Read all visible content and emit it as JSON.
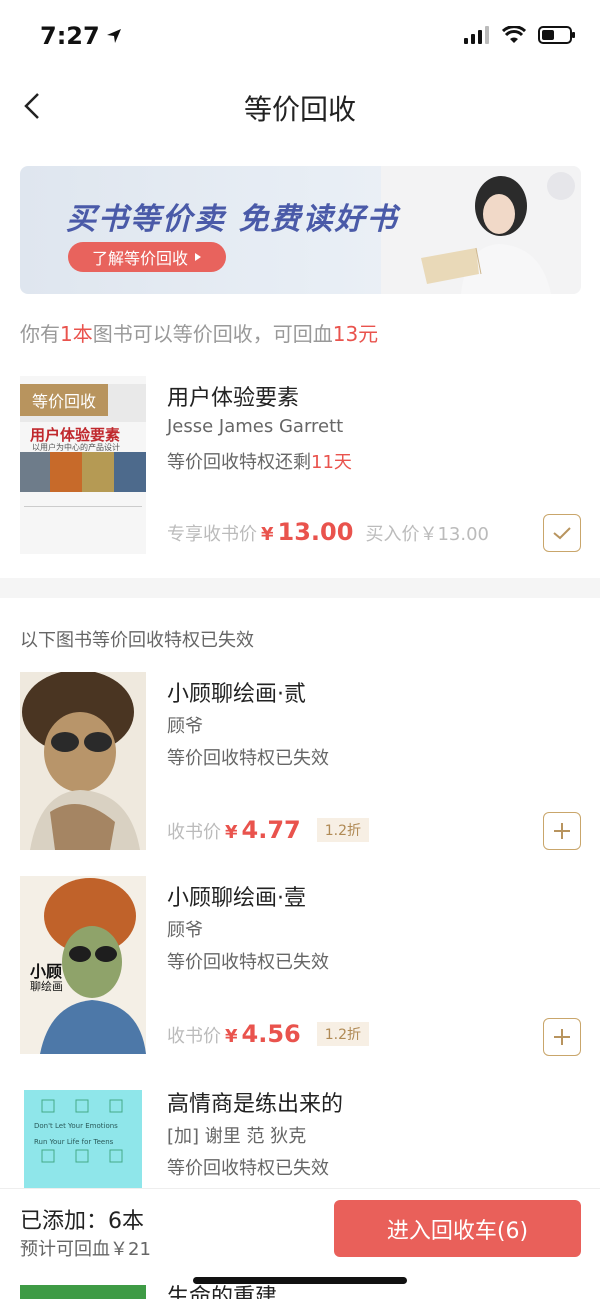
{
  "status_bar": {
    "time": "7:27"
  },
  "nav": {
    "title": "等价回收"
  },
  "banner": {
    "headline": "买书等价卖 免费读好书",
    "button_label": "了解等价回收"
  },
  "summary": {
    "prefix": "你有",
    "count": "1本",
    "middle": "图书可以等价回收，可回血",
    "amount": "13元"
  },
  "eligible_book": {
    "tag": "等价回收",
    "title": "用户体验要素",
    "author": "Jesse James Garrett",
    "status_prefix": "等价回收特权还剩",
    "status_days": "11天",
    "price_label": "专享收书价",
    "currency": "¥",
    "price": "13.00",
    "buy_price": "买入价￥13.00",
    "selected": true,
    "cover_title": "用户体验要素",
    "cover_subtitle": "以用户为中心的产品设计"
  },
  "section": {
    "label": "以下图书等价回收特权已失效"
  },
  "expired_books": [
    {
      "title": "小顾聊绘画·贰",
      "author": "顾爷",
      "status": "等价回收特权已失效",
      "price_label": "收书价",
      "currency": "¥",
      "price": "4.77",
      "discount": "1.2折"
    },
    {
      "title": "小顾聊绘画·壹",
      "author": "顾爷",
      "status": "等价回收特权已失效",
      "price_label": "收书价",
      "currency": "¥",
      "price": "4.56",
      "discount": "1.2折",
      "cover_title": "小顾",
      "cover_subtitle": "聊绘画"
    },
    {
      "title": "高情商是练出来的",
      "author": "[加] 谢里 范 狄克",
      "status": "等价回收特权已失效",
      "cover_line1": "Don't Let Your Emotions",
      "cover_line2": "Run Your Life for Teens"
    },
    {
      "title": "生命的重建"
    }
  ],
  "bottom": {
    "added": "已添加：6本",
    "estimate": "预计可回血￥21",
    "cart_button": "进入回收车(6)"
  },
  "colors": {
    "accent_red": "#e9534d",
    "gold": "#b8945e",
    "button_red": "#e9605a"
  }
}
